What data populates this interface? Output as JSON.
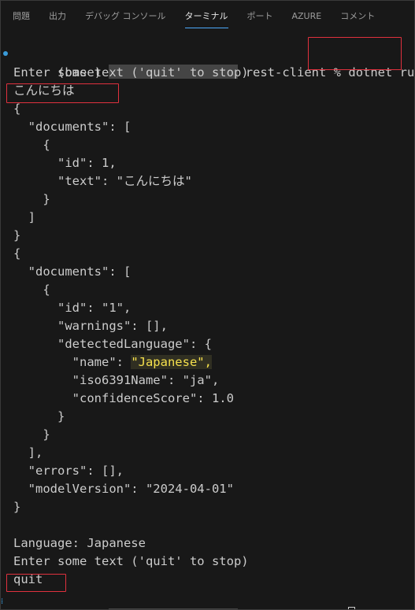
{
  "tabs": [
    {
      "label": "問題",
      "active": false
    },
    {
      "label": "出力",
      "active": false
    },
    {
      "label": "デバッグ コンソール",
      "active": false
    },
    {
      "label": "ターミナル",
      "active": true
    },
    {
      "label": "ポート",
      "active": false
    },
    {
      "label": "AZURE",
      "active": false
    },
    {
      "label": "コメント",
      "active": false
    }
  ],
  "terminal": {
    "prompt_prefix": "(base)",
    "prompt_dir": "rest-client %",
    "command": "dotnet run",
    "lines": [
      "Enter some text ('quit' to stop)",
      "こんにちは",
      "{",
      "  \"documents\": [",
      "    {",
      "      \"id\": 1,",
      "      \"text\": \"こんにちは\"",
      "    }",
      "  ]",
      "}",
      "{",
      "  \"documents\": [",
      "    {",
      "      \"id\": \"1\",",
      "      \"warnings\": [],",
      "      \"detectedLanguage\": {",
      "        \"name\": ",
      "        \"iso6391Name\": \"ja\",",
      "        \"confidenceScore\": 1.0",
      "      }",
      "    }",
      "  ],",
      "  \"errors\": [],",
      "  \"modelVersion\": \"2024-04-01\"",
      "}",
      "",
      "Language: Japanese",
      "Enter some text ('quit' to stop)",
      "quit"
    ],
    "highlighted_value": "\"Japanese\",",
    "accent_color": "#f5e04c",
    "annotation_color": "#e0313e"
  }
}
